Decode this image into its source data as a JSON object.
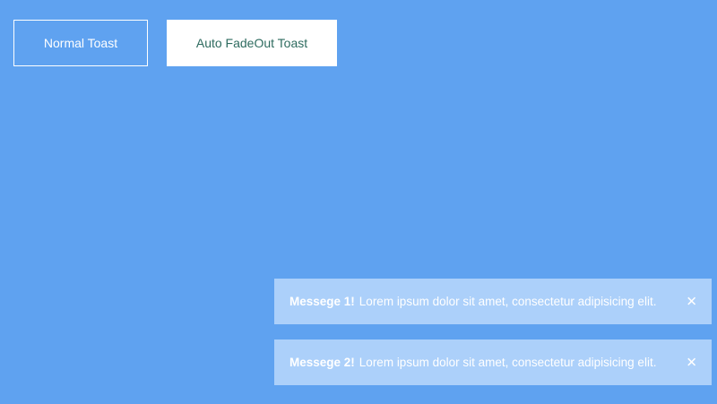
{
  "colors": {
    "background": "#5fa2f0",
    "toast_background": "#acd0fa",
    "button_text_fade": "#2e6b5f",
    "white": "#ffffff"
  },
  "buttons": {
    "normal_label": "Normal Toast",
    "fade_label": "Auto FadeOut Toast"
  },
  "toasts": [
    {
      "title": "Messege 1!",
      "message": "Lorem ipsum dolor sit amet, consectetur adipisicing elit.",
      "close_icon": "close-icon",
      "close_glyph": "✕"
    },
    {
      "title": "Messege 2!",
      "message": "Lorem ipsum dolor sit amet, consectetur adipisicing elit.",
      "close_icon": "close-icon",
      "close_glyph": "✕"
    }
  ]
}
